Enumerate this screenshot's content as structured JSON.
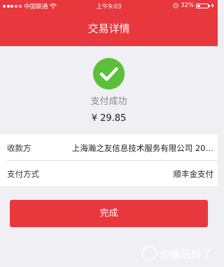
{
  "status_bar": {
    "carrier": "中国联通",
    "time": "上午9:03",
    "battery": "32%",
    "battery_level": 0.32,
    "wifi_icon": "wifi-icon",
    "alarm_icon": "alarm-icon",
    "charging_icon": "lightning-icon"
  },
  "header": {
    "title": "交易详情",
    "background": "#e8373d"
  },
  "result": {
    "icon": "checkmark-icon",
    "icon_color": "#5bbf3a",
    "status": "支付成功",
    "amount": "¥ 29.85"
  },
  "details": [
    {
      "label": "收款方",
      "value": "上海瀚之友信息技术服务有限公司 20…"
    },
    {
      "label": "支付方式",
      "value": "顺丰金支付"
    }
  ],
  "actions": {
    "done_label": "完成"
  },
  "watermark": "你搞玩转了"
}
